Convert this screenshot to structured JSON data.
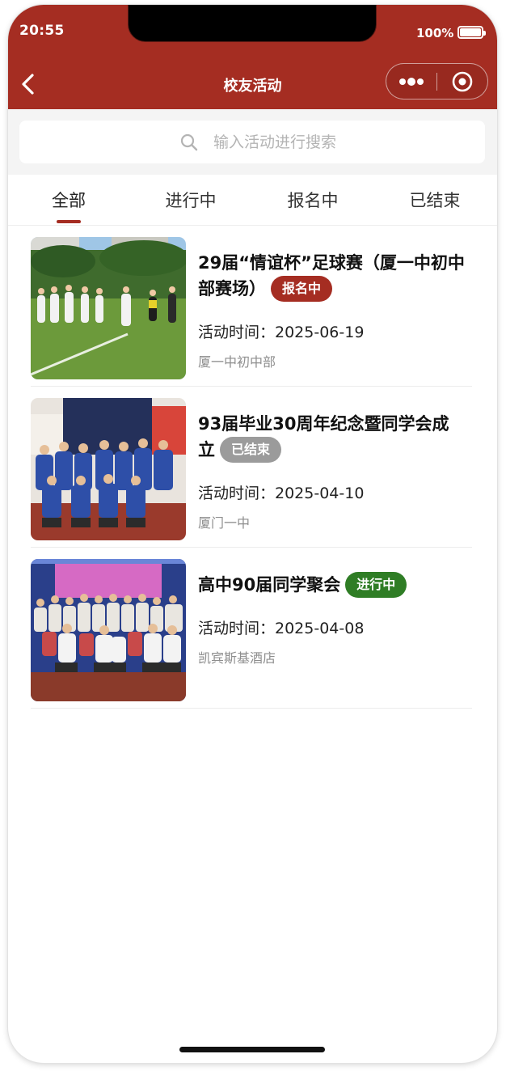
{
  "status_bar": {
    "time": "20:55",
    "battery": "100%"
  },
  "nav": {
    "title": "校友活动"
  },
  "search": {
    "placeholder": "输入活动进行搜索"
  },
  "tabs": [
    {
      "label": "全部",
      "active": true
    },
    {
      "label": "进行中",
      "active": false
    },
    {
      "label": "报名中",
      "active": false
    },
    {
      "label": "已结束",
      "active": false
    }
  ],
  "events": [
    {
      "title": "29届“情谊杯”足球赛（厦一中初中部赛场）",
      "status": "报名中",
      "status_color": "#a52d22",
      "time": "活动时间：2025-06-19",
      "place": "厦一中初中部"
    },
    {
      "title": "93届毕业30周年纪念暨同学会成立",
      "status": "已结束",
      "status_color": "#9b9b9b",
      "time": "活动时间：2025-04-10",
      "place": "厦门一中"
    },
    {
      "title": "高中90届同学聚会",
      "status": "进行中",
      "status_color": "#2f7d25",
      "time": "活动时间：2025-04-08",
      "place": "凯宾斯基酒店"
    }
  ],
  "colors": {
    "brand": "#a52d22",
    "ongoing": "#2f7d25",
    "ended": "#9b9b9b"
  },
  "icons": [
    "back-icon",
    "more-dots-icon",
    "close-circle-icon",
    "search-icon"
  ]
}
